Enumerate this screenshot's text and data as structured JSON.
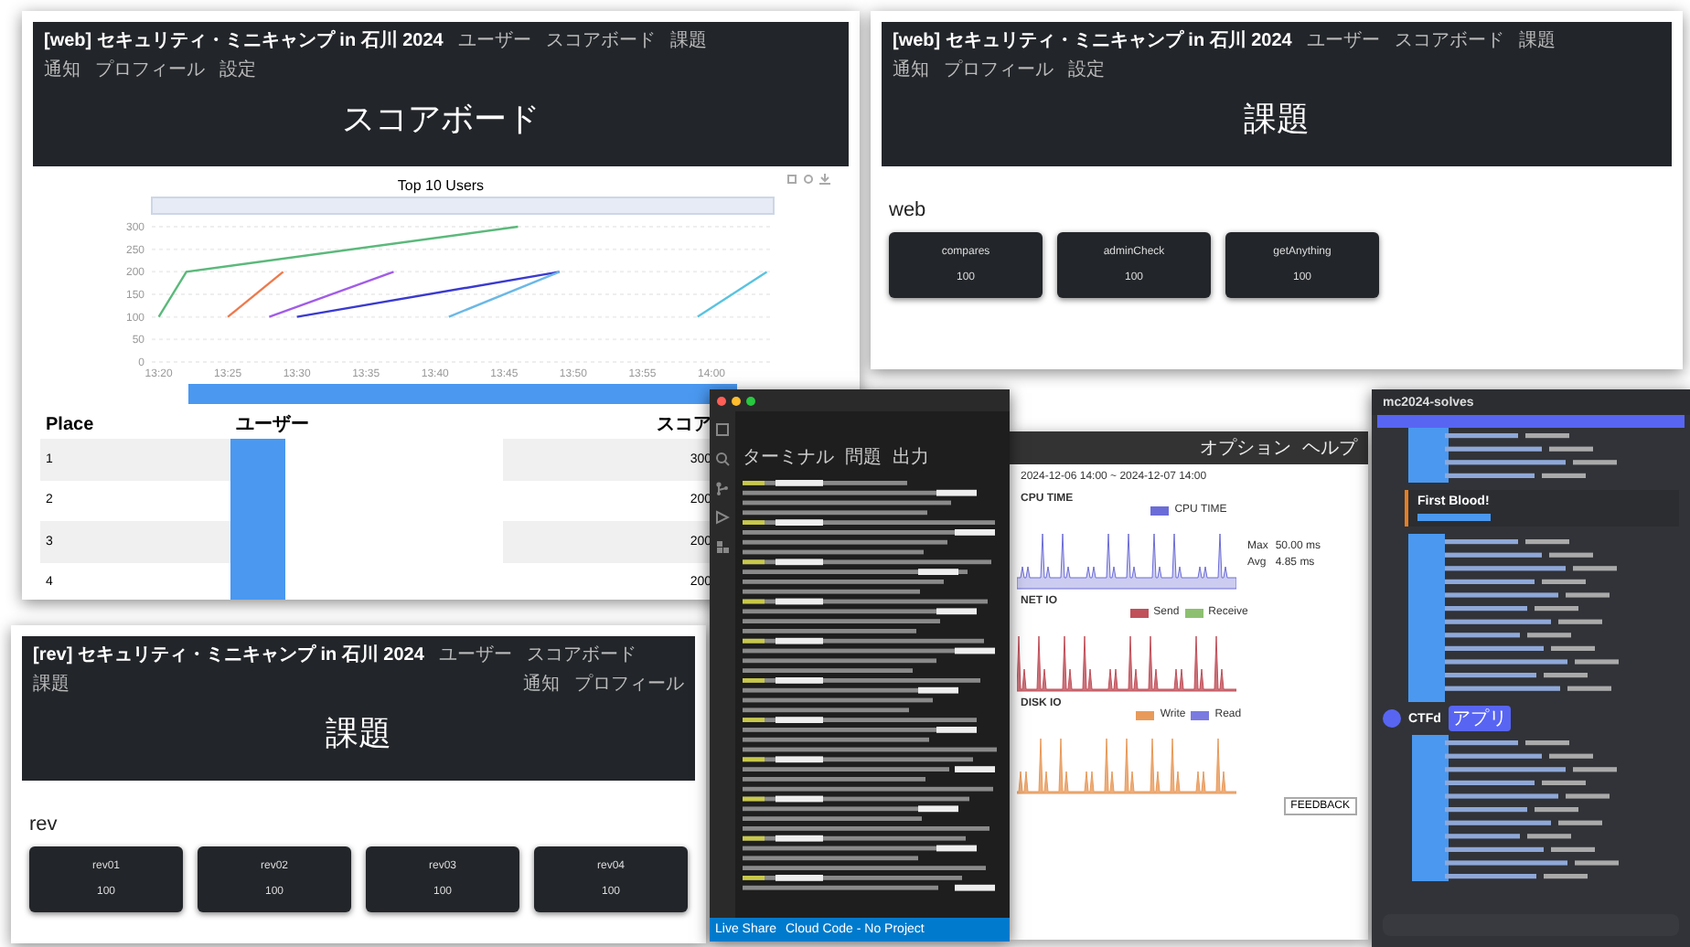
{
  "scoreboard_window": {
    "site_title": "[web] セキュリティ・ミニキャンプ in 石川 2024",
    "nav": [
      "ユーザー",
      "スコアボード",
      "課題"
    ],
    "user_menu": [
      "通知",
      "プロフィール",
      "設定"
    ],
    "heading": "スコアボード",
    "chart_data": {
      "type": "line",
      "title": "Top 10 Users",
      "grid": true,
      "ylim": [
        0,
        300
      ],
      "categories": [
        "13:20",
        null,
        null,
        null,
        null,
        "13:25",
        null,
        null,
        null,
        null,
        "13:30",
        null,
        null,
        null,
        null,
        "13:35",
        null,
        null,
        null,
        null,
        "13:40",
        null,
        null,
        null,
        null,
        "13:45",
        null,
        null,
        null,
        null,
        "13:50",
        null,
        null,
        null,
        null,
        "13:55",
        null,
        null,
        null,
        null,
        "14:00",
        null,
        null,
        null,
        null
      ],
      "yticks": [
        0,
        50,
        100,
        150,
        200,
        250,
        300
      ],
      "series": [
        {
          "color": "#5bb97b",
          "values": [
            100,
            null,
            200,
            null,
            null,
            null,
            null,
            null,
            null,
            null,
            null,
            null,
            null,
            null,
            null,
            null,
            null,
            null,
            null,
            null,
            null,
            null,
            null,
            null,
            null,
            null,
            300,
            null,
            null,
            null,
            null,
            null,
            null,
            null,
            null,
            null,
            null,
            null,
            null,
            null,
            null,
            null,
            null,
            null,
            null
          ]
        },
        {
          "color": "#ee7a4c",
          "values": [
            null,
            null,
            null,
            null,
            null,
            100,
            null,
            null,
            null,
            200,
            null,
            null,
            null,
            null,
            null,
            null,
            null,
            null,
            null,
            null,
            null,
            null,
            null,
            null,
            null,
            null,
            null,
            null,
            null,
            null,
            null,
            null,
            null,
            null,
            null,
            null,
            null,
            null,
            null,
            null,
            null,
            null,
            null,
            null,
            null
          ]
        },
        {
          "color": "#a25ce8",
          "values": [
            null,
            null,
            null,
            null,
            null,
            null,
            null,
            null,
            100,
            null,
            null,
            null,
            null,
            null,
            null,
            null,
            null,
            200,
            null,
            null,
            null,
            null,
            null,
            null,
            null,
            null,
            null,
            null,
            null,
            null,
            null,
            null,
            null,
            null,
            null,
            null,
            null,
            null,
            null,
            null,
            null,
            null,
            null,
            null,
            null
          ]
        },
        {
          "color": "#3a3ad0",
          "values": [
            null,
            null,
            null,
            null,
            null,
            null,
            null,
            null,
            null,
            null,
            100,
            null,
            null,
            null,
            null,
            null,
            null,
            null,
            null,
            null,
            null,
            null,
            null,
            null,
            null,
            null,
            null,
            null,
            null,
            200,
            null,
            null,
            null,
            null,
            null,
            null,
            null,
            null,
            null,
            null,
            null,
            null,
            null,
            null,
            null
          ]
        },
        {
          "color": "#6bb8e6",
          "values": [
            null,
            null,
            null,
            null,
            null,
            null,
            null,
            null,
            null,
            null,
            null,
            null,
            null,
            null,
            null,
            null,
            null,
            null,
            null,
            null,
            null,
            100,
            null,
            null,
            null,
            null,
            null,
            null,
            null,
            200,
            null,
            null,
            null,
            null,
            null,
            null,
            null,
            null,
            null,
            null,
            null,
            null,
            null,
            null,
            null
          ]
        },
        {
          "color": "#59c3e0",
          "values": [
            null,
            null,
            null,
            null,
            null,
            null,
            null,
            null,
            null,
            null,
            null,
            null,
            null,
            null,
            null,
            null,
            null,
            null,
            null,
            null,
            null,
            null,
            null,
            null,
            null,
            null,
            null,
            null,
            null,
            null,
            null,
            null,
            null,
            null,
            null,
            null,
            null,
            null,
            null,
            100,
            null,
            null,
            null,
            null,
            200
          ]
        }
      ]
    },
    "table": {
      "columns": [
        "Place",
        "ユーザー",
        "スコア"
      ],
      "rows": [
        {
          "place": "1",
          "score": "300"
        },
        {
          "place": "2",
          "score": "200"
        },
        {
          "place": "3",
          "score": "200"
        },
        {
          "place": "4",
          "score": "200"
        }
      ]
    }
  },
  "web_challenges_window": {
    "site_title": "[web] セキュリティ・ミニキャンプ in 石川 2024",
    "nav": [
      "ユーザー",
      "スコアボード",
      "課題"
    ],
    "user_menu": [
      "通知",
      "プロフィール",
      "設定"
    ],
    "heading": "課題",
    "category": "web",
    "challenges": [
      {
        "name": "compares",
        "points": "100"
      },
      {
        "name": "adminCheck",
        "points": "100"
      },
      {
        "name": "getAnything",
        "points": "100"
      }
    ]
  },
  "rev_challenges_window": {
    "site_title": "[rev] セキュリティ・ミニキャンプ in 石川 2024",
    "nav": [
      "ユーザー",
      "スコアボード",
      "課題"
    ],
    "user_menu": [
      "通知",
      "プロフィール"
    ],
    "heading": "課題",
    "category": "rev",
    "challenges": [
      {
        "name": "rev01",
        "points": "100"
      },
      {
        "name": "rev02",
        "points": "100"
      },
      {
        "name": "rev03",
        "points": "100"
      },
      {
        "name": "rev04",
        "points": "100"
      }
    ]
  },
  "terminal_window": {
    "panel_tabs": [
      "ターミナル",
      "問題",
      "出力"
    ],
    "status_items": [
      "Live Share",
      "Cloud Code - No Project"
    ]
  },
  "monitor_window": {
    "menu": [
      "オプション",
      "ヘルプ"
    ],
    "date_range": "2024-12-06 14:00 ~ 2024-12-07 14:00",
    "graphs": [
      {
        "title": "CPU TIME",
        "legend": [
          {
            "label": "CPU TIME",
            "color": "#6c6cd8"
          }
        ],
        "stats": [
          {
            "label": "Max",
            "value": "50.00 ms"
          },
          {
            "label": "Avg",
            "value": "4.85 ms"
          }
        ]
      },
      {
        "title": "NET IO",
        "legend": [
          {
            "label": "Send",
            "color": "#c0505a"
          },
          {
            "label": "Receive",
            "color": "#8cc070"
          }
        ]
      },
      {
        "title": "DISK IO",
        "legend": [
          {
            "label": "Write",
            "color": "#e89a5a"
          },
          {
            "label": "Read",
            "color": "#7a7ae0"
          }
        ]
      }
    ],
    "feedback": "FEEDBACK"
  },
  "chat_window": {
    "channel": "mc2024-solves",
    "first_blood": "First Blood!",
    "bot_name": "CTFd",
    "bot_tag": "アプリ"
  }
}
